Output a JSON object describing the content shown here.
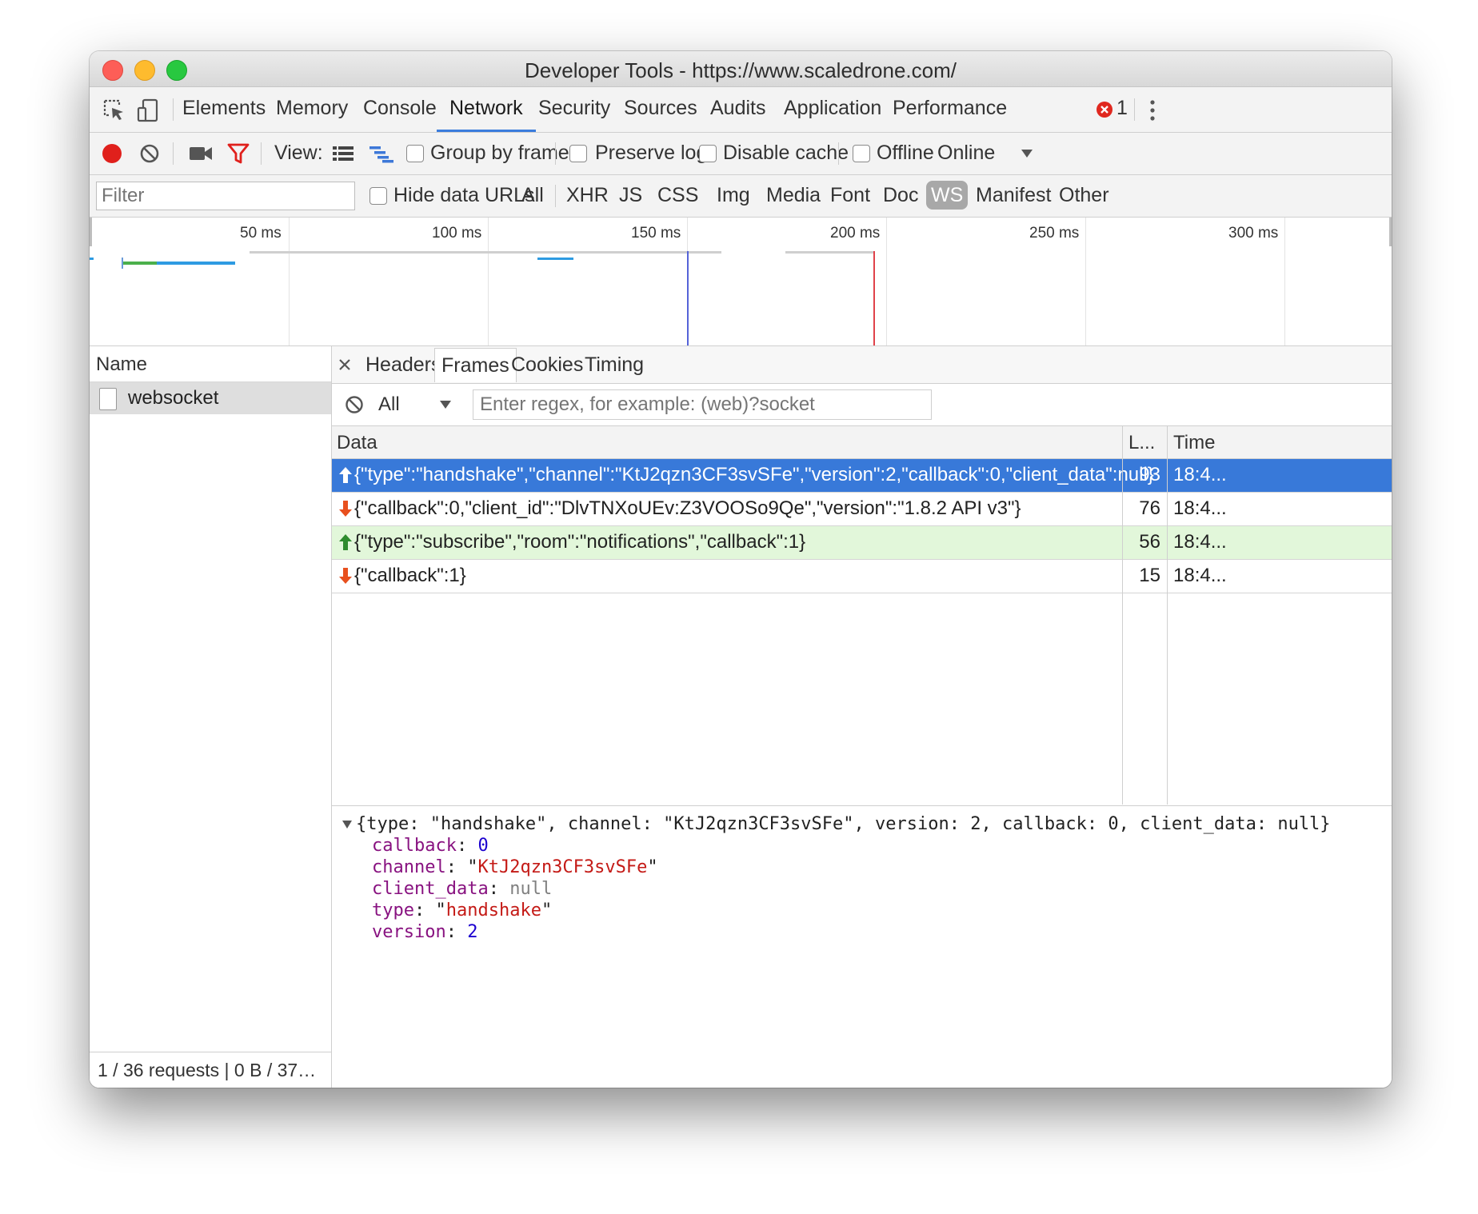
{
  "window": {
    "title": "Developer Tools - https://www.scaledrone.com/"
  },
  "panel_tabs": [
    "Elements",
    "Memory",
    "Console",
    "Network",
    "Security",
    "Sources",
    "Audits",
    "Application",
    "Performance"
  ],
  "active_panel": "Network",
  "error_count": "1",
  "toolbar": {
    "view_label": "View:",
    "group_by_frame": "Group by frame",
    "preserve_log": "Preserve log",
    "disable_cache": "Disable cache",
    "offline": "Offline",
    "throttle_value": "Online"
  },
  "filterbar": {
    "filter_placeholder": "Filter",
    "hide_data_urls": "Hide data URLs",
    "types": [
      "All",
      "XHR",
      "JS",
      "CSS",
      "Img",
      "Media",
      "Font",
      "Doc",
      "WS",
      "Manifest",
      "Other"
    ],
    "active_type": "WS"
  },
  "overview": {
    "ticks": [
      "50 ms",
      "100 ms",
      "150 ms",
      "200 ms",
      "250 ms",
      "300 ms"
    ]
  },
  "requests": {
    "column_name": "Name",
    "items": [
      {
        "name": "websocket"
      }
    ],
    "status": "1 / 36 requests | 0 B / 37…"
  },
  "detail_tabs": [
    "Headers",
    "Frames",
    "Cookies",
    "Timing"
  ],
  "active_detail_tab": "Frames",
  "frames_filter": {
    "type_value": "All",
    "regex_placeholder": "Enter regex, for example: (web)?socket"
  },
  "frames_table": {
    "columns": {
      "data": "Data",
      "length": "L...",
      "time": "Time"
    },
    "rows": [
      {
        "direction": "sent",
        "data": "{\"type\":\"handshake\",\"channel\":\"KtJ2qzn3CF3svSFe\",\"version\":2,\"callback\":0,\"client_data\":null}",
        "length": "93",
        "time": "18:4..."
      },
      {
        "direction": "received",
        "data": "{\"callback\":0,\"client_id\":\"DlvTNXoUEv:Z3VOOSo9Qe\",\"version\":\"1.8.2 API v3\"}",
        "length": "76",
        "time": "18:4..."
      },
      {
        "direction": "sent",
        "data": "{\"type\":\"subscribe\",\"room\":\"notifications\",\"callback\":1}",
        "length": "56",
        "time": "18:4..."
      },
      {
        "direction": "received",
        "data": "{\"callback\":1}",
        "length": "15",
        "time": "18:4..."
      }
    ]
  },
  "frame_detail": {
    "summary": "{type: \"handshake\", channel: \"KtJ2qzn3CF3svSFe\", version: 2, callback: 0, client_data: null}",
    "properties": [
      {
        "key": "callback",
        "value": "0",
        "kind": "number"
      },
      {
        "key": "channel",
        "value": "KtJ2qzn3CF3svSFe",
        "kind": "string"
      },
      {
        "key": "client_data",
        "value": "null",
        "kind": "null"
      },
      {
        "key": "type",
        "value": "handshake",
        "kind": "string"
      },
      {
        "key": "version",
        "value": "2",
        "kind": "number"
      }
    ]
  },
  "colors": {
    "selection": "#3879d9",
    "sent_row": "#e2f7da",
    "sent_arrow": "#2e8b2e",
    "received_arrow": "#e8501e",
    "record": "#e0201c",
    "active_tab_underline": "#3b7ddd"
  },
  "icons": [
    "inspect-icon",
    "device-toolbar-icon",
    "error-icon",
    "more-menu-icon",
    "record-icon",
    "clear-icon",
    "camera-icon",
    "filter-icon",
    "list-view-icon",
    "waterfall-view-icon",
    "dropdown-arrow-icon",
    "close-icon",
    "block-icon",
    "sent-arrow-icon",
    "received-arrow-icon",
    "expand-triangle-icon"
  ]
}
